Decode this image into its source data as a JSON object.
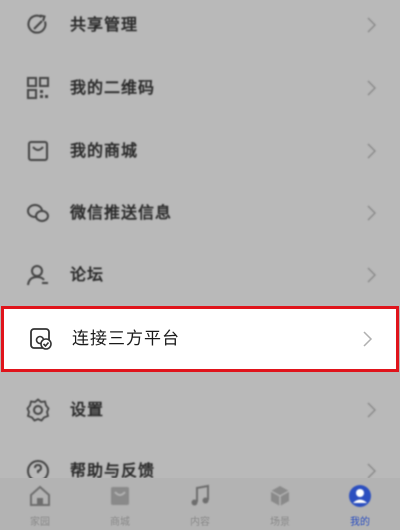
{
  "menu": {
    "items": [
      {
        "label": "共享管理",
        "icon": "share-refresh-icon"
      },
      {
        "label": "我的二维码",
        "icon": "qr-code-icon"
      },
      {
        "label": "我的商城",
        "icon": "shopping-bag-icon"
      },
      {
        "label": "微信推送信息",
        "icon": "wechat-icon"
      },
      {
        "label": "论坛",
        "icon": "user-forum-icon"
      },
      {
        "label": "连接三方平台",
        "icon": "connect-platform-icon",
        "highlighted": true
      },
      {
        "label": "设置",
        "icon": "gear-icon"
      },
      {
        "label": "帮助与反馈",
        "icon": "help-icon"
      }
    ]
  },
  "tabbar": {
    "tabs": [
      {
        "label": "家园",
        "icon": "home-icon"
      },
      {
        "label": "商城",
        "icon": "store-icon"
      },
      {
        "label": "内容",
        "icon": "music-note-icon"
      },
      {
        "label": "场景",
        "icon": "scene-box-icon"
      },
      {
        "label": "我的",
        "icon": "profile-icon",
        "active": true
      }
    ]
  },
  "colors": {
    "overlay_gray": "#b9b9b9",
    "highlight_border": "#e0141b",
    "active_tab": "#2c4fbf"
  }
}
